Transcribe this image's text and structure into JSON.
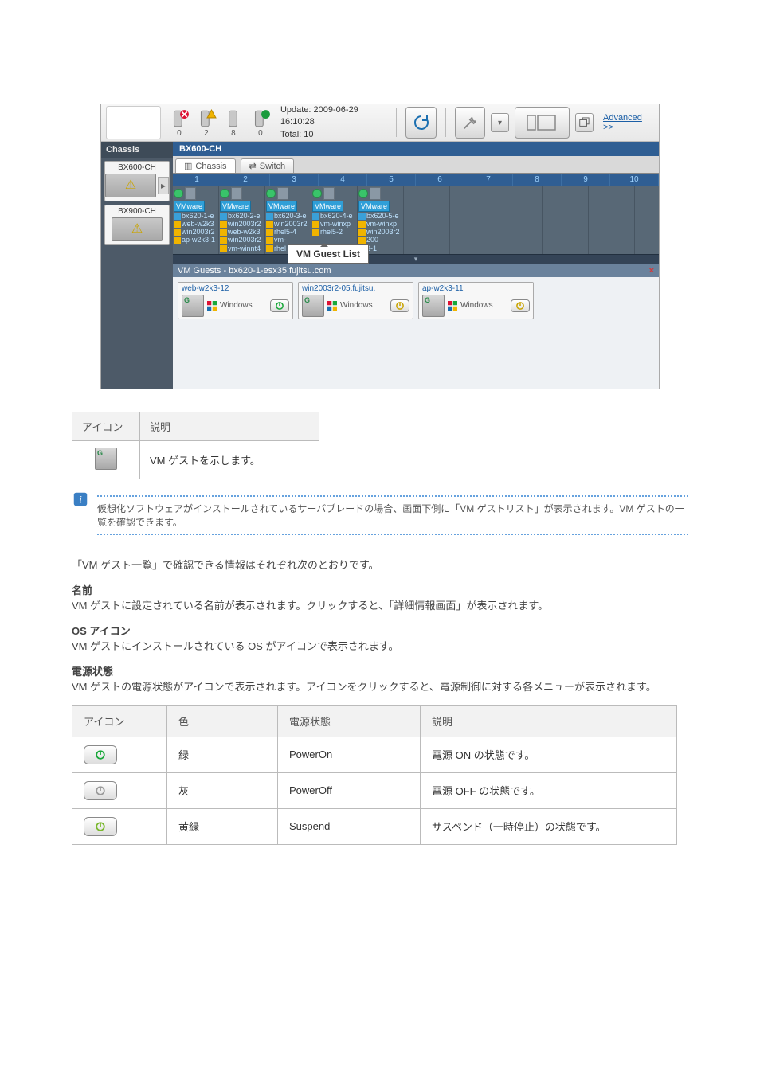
{
  "topbar": {
    "counters": [
      {
        "value": 0,
        "name": "error-icon"
      },
      {
        "value": 2,
        "name": "warning-icon"
      },
      {
        "value": 8,
        "name": "unknown-icon"
      },
      {
        "value": 0,
        "name": "ok-icon"
      }
    ],
    "update_label": "Update:",
    "update_time": "2009-06-29 16:10:28",
    "total_label": "Total:",
    "total_value": 10,
    "advanced_label": "Advanced >>"
  },
  "sidebar": {
    "header": "Chassis",
    "items": [
      {
        "label": "BX600-CH"
      },
      {
        "label": "BX900-CH"
      }
    ]
  },
  "main": {
    "breadcrumb": "BX600-CH",
    "tabs": [
      {
        "label": "Chassis"
      },
      {
        "label": "Switch"
      }
    ],
    "slots": [
      1,
      2,
      3,
      4,
      5,
      6,
      7,
      8,
      9,
      10
    ],
    "blades": [
      {
        "vmw": "VMware",
        "host": "bx620-1-e",
        "vms": [
          "web-w2k3",
          "win2003r2",
          "ap-w2k3-1"
        ]
      },
      {
        "vmw": "VMware",
        "host": "bx620-2-e",
        "vms": [
          "win2003r2",
          "web-w2k3",
          "win2003r2",
          "vm-winnt4"
        ]
      },
      {
        "vmw": "VMware",
        "host": "bx620-3-e",
        "vms": [
          "win2003r2",
          "rhel5-4",
          "vm-",
          "rhel"
        ]
      },
      {
        "vmw": "VMware",
        "host": "bx620-4-e",
        "vms": [
          "vm-winxp",
          "rhel5-2"
        ]
      },
      {
        "vmw": "VMware",
        "host": "bx620-5-e",
        "vms": [
          "vm-winxp",
          "win2003r2",
          "200",
          "3-1"
        ]
      }
    ],
    "callout": "VM Guest List",
    "guest_header": "VM Guests - bx620-1-esx35.fujitsu.com",
    "close_glyph": "×",
    "guests": [
      {
        "name": "web-w2k3-12",
        "os": "Windows",
        "power": "on"
      },
      {
        "name": "win2003r2-05.fujitsu.",
        "os": "Windows",
        "power": "suspended"
      },
      {
        "name": "ap-w2k3-11",
        "os": "Windows",
        "power": "suspended"
      }
    ]
  },
  "below": {
    "icon_table_headers": [
      "アイコン",
      "説明"
    ],
    "icon_table_row_desc": "VM ゲストを示します。",
    "info_text": "仮想化ソフトウェアがインストールされているサーバブレードの場合、画面下側に「VM ゲストリスト」が表示されます。VM ゲストの一覧を確認できます。",
    "section_para": "「VM ゲスト一覧」で確認できる情報はそれぞれ次のとおりです。",
    "name_label": "名前",
    "name_desc": "VM ゲストに設定されている名前が表示されます。クリックすると、「詳細情報画面」が表示されます。",
    "os_label": "OS アイコン",
    "os_desc": "VM ゲストにインストールされている OS がアイコンで表示されます。",
    "power_label": "電源状態",
    "power_desc": "VM ゲストの電源状態がアイコンで表示されます。アイコンをクリックすると、電源制御に対する各メニューが表示されます。",
    "power_table": {
      "headers": [
        "アイコン",
        "色",
        "電源状態",
        "説明"
      ],
      "rows": [
        {
          "color": "緑",
          "state": "PowerOn",
          "desc": "電源 ON の状態です。"
        },
        {
          "color": "灰",
          "state": "PowerOff",
          "desc": "電源 OFF の状態です。"
        },
        {
          "color": "黄緑",
          "state": "Suspend",
          "desc": "サスペンド（一時停止）の状態です。"
        }
      ]
    }
  },
  "icons": {
    "chassis_glyph": "▥",
    "switch_glyph": "⇄"
  }
}
